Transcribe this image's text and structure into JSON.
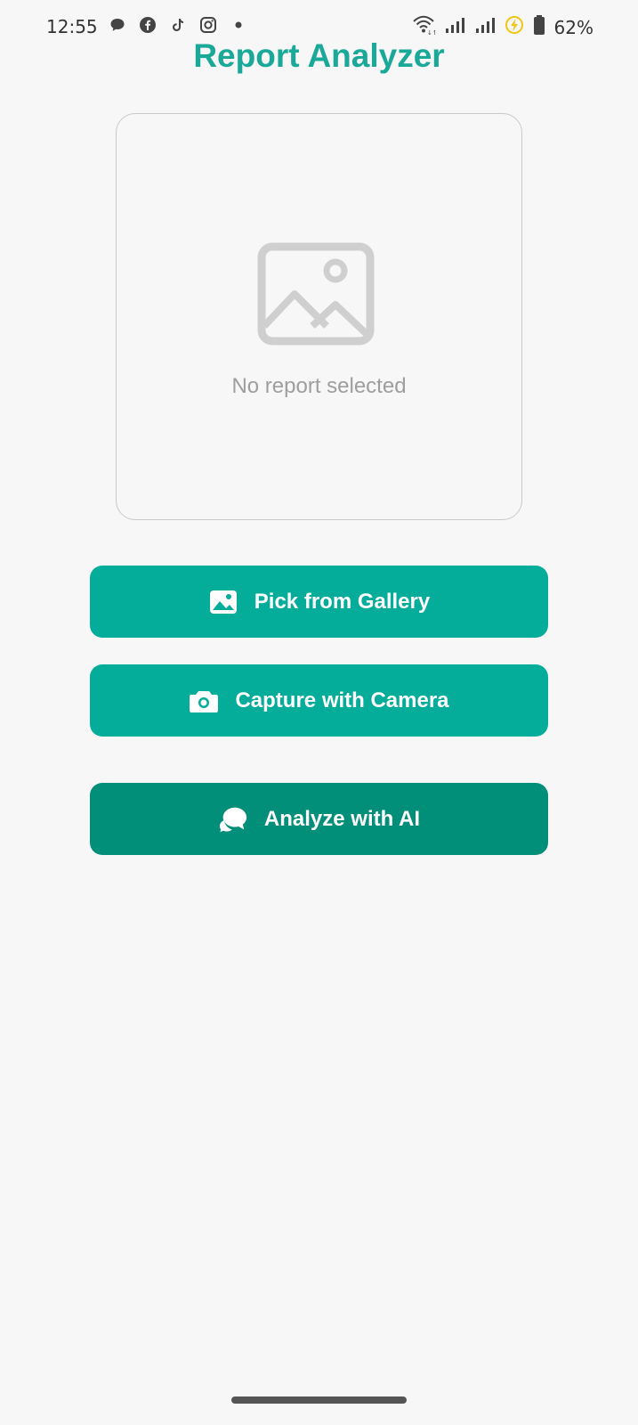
{
  "status_bar": {
    "time": "12:55",
    "left_icons": [
      "chat-bubble-icon",
      "facebook-icon",
      "tiktok-icon",
      "instagram-icon",
      "dot-icon"
    ],
    "right_icons": [
      "wifi-icon",
      "signal-icon",
      "signal-icon",
      "charging-icon",
      "battery-icon"
    ],
    "battery_percent": "62%"
  },
  "header": {
    "title": "Report Analyzer"
  },
  "preview": {
    "icon": "image-placeholder-icon",
    "empty_text": "No report selected"
  },
  "actions": {
    "gallery": {
      "label": "Pick from Gallery",
      "icon": "image-icon"
    },
    "camera": {
      "label": "Capture with Camera",
      "icon": "camera-icon"
    },
    "analyze": {
      "label": "Analyze with AI",
      "icon": "chat-bubbles-icon"
    }
  },
  "colors": {
    "accent": "#1aa898",
    "button_primary": "#04ad9a",
    "button_analyze": "#028f79",
    "background": "#f7f7f7",
    "placeholder_text": "#9e9e9e"
  }
}
